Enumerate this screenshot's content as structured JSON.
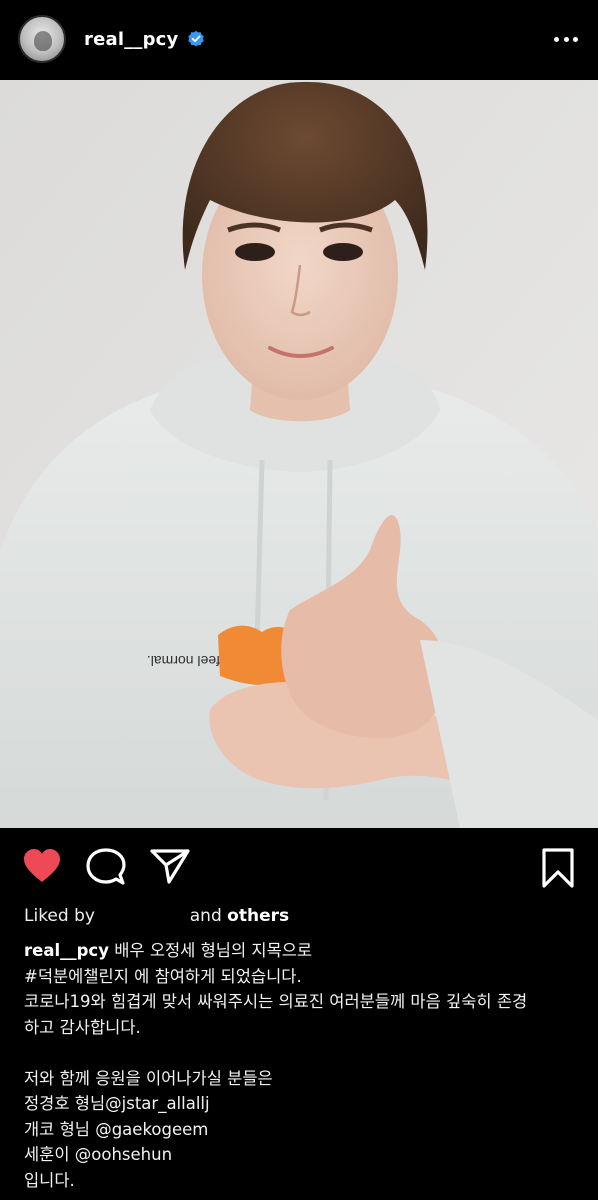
{
  "post": {
    "username": "real__pcy",
    "verified_icon": "verified-badge-icon",
    "more_icon": "more-options-icon"
  },
  "actions": {
    "like_icon": "heart-filled-icon",
    "comment_icon": "comment-icon",
    "share_icon": "send-icon",
    "save_icon": "bookmark-icon",
    "like_color": "#ed4956"
  },
  "likes": {
    "prefix": "Liked by",
    "suffix_and": "and",
    "suffix_others": "others"
  },
  "caption": {
    "username": "real__pcy",
    "line1": "배우 오정세 형님의 지목으로",
    "hashtag": "#덕분에챌린지",
    "line2_rest": " 에 참여하게 되었습니다.",
    "line3": "코로나19와 힘겹게 맞서 싸워주시는 의료진 여러분들께 마음 깊숙히 존경",
    "line4": "하고 감사합니다.",
    "line5": "저와 함께 응원을 이어나가실 분들은",
    "line6": "정경호 형님@jstar_allallj",
    "line7": "개코 형님 @gaekogeem",
    "line8": "세훈이 @oohsehun",
    "line9": "입니다."
  },
  "photo_text": {
    "hoodie_print": "feel normal."
  }
}
